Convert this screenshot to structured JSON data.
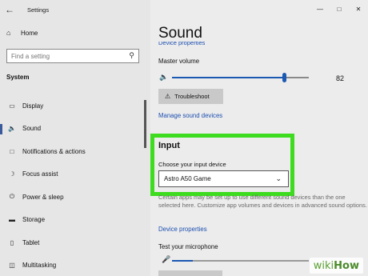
{
  "window": {
    "title": "Settings"
  },
  "sidebar": {
    "home_label": "Home",
    "search_placeholder": "Find a setting",
    "section_label": "System",
    "items": [
      {
        "label": "Display",
        "icon": "display-icon"
      },
      {
        "label": "Sound",
        "icon": "speaker-icon",
        "active": true
      },
      {
        "label": "Notifications & actions",
        "icon": "notification-icon"
      },
      {
        "label": "Focus assist",
        "icon": "moon-icon"
      },
      {
        "label": "Power & sleep",
        "icon": "power-icon"
      },
      {
        "label": "Storage",
        "icon": "storage-icon"
      },
      {
        "label": "Tablet",
        "icon": "tablet-icon"
      },
      {
        "label": "Multitasking",
        "icon": "multitasking-icon"
      }
    ]
  },
  "main": {
    "title": "Sound",
    "partial_link": "Device properties",
    "master_volume_label": "Master volume",
    "master_volume_value": "82",
    "troubleshoot_label": "Troubleshoot",
    "manage_devices_link": "Manage sound devices",
    "input": {
      "heading": "Input",
      "choose_label": "Choose your input device",
      "selected_device": "Astro A50 Game"
    },
    "note": "Certain apps may be set up to use different sound devices than the one selected here. Customize app volumes and devices in advanced sound options.",
    "device_properties_link": "Device properties",
    "test_mic_label": "Test your microphone",
    "mic_level": 0.15
  },
  "watermark": {
    "part1": "wiki",
    "part2": "How"
  },
  "colors": {
    "accent": "#1b59b3",
    "highlight": "#3ddc1f",
    "link": "#1c4fb0"
  }
}
